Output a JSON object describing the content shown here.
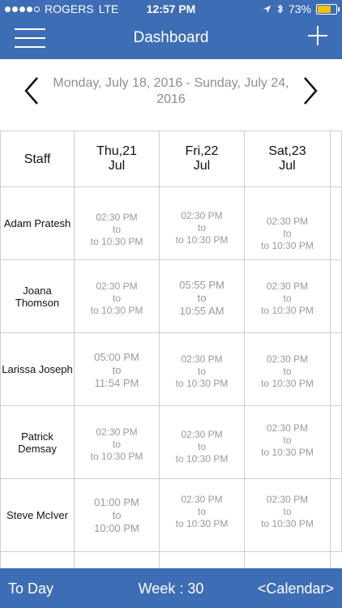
{
  "status": {
    "carrier": "ROGERS",
    "network": "LTE",
    "time": "12:57 PM",
    "battery": "73%",
    "battery_level": 0.73,
    "signal_bars": 4,
    "icons": [
      "location-icon",
      "bluetooth-icon"
    ]
  },
  "header": {
    "title": "Dashboard",
    "menu_icon": "hamburger-icon",
    "add_icon": "plus-icon"
  },
  "week": {
    "range": "Monday, July 18, 2016 - Sunday, July 24, 2016",
    "prev_icon": "chevron-left-icon",
    "next_icon": "chevron-right-icon"
  },
  "table": {
    "staff_header": "Staff",
    "days": [
      {
        "day": "Thu,21",
        "month": "Jul"
      },
      {
        "day": "Fri,22",
        "month": "Jul"
      },
      {
        "day": "Sat,23",
        "month": "Jul"
      }
    ],
    "rows": [
      {
        "name": "Adam  Pratesh",
        "shifts": [
          {
            "start": "02:30 PM",
            "sep": "to",
            "end": "to 10:30 PM"
          },
          {
            "start": "02:30 PM",
            "sep": "to",
            "end": "to 10:30 PM"
          },
          {
            "start": "02:30 PM",
            "sep": "to",
            "end": "to 10:30 PM"
          }
        ]
      },
      {
        "name": "Joana Thomson",
        "shifts": [
          {
            "start": "02:30 PM",
            "sep": "to",
            "end": "to 10:30 PM"
          },
          {
            "start": "05:55 PM",
            "sep": "to",
            "end": "10:55 AM"
          },
          {
            "start": "02:30 PM",
            "sep": "to",
            "end": "to 10:30 PM"
          }
        ]
      },
      {
        "name": "Larissa Joseph",
        "shifts": [
          {
            "start": "05:00 PM",
            "sep": "to",
            "end": "11:54 PM"
          },
          {
            "start": "02:30 PM",
            "sep": "to",
            "end": "to 10:30 PM"
          },
          {
            "start": "02:30 PM",
            "sep": "to",
            "end": "to 10:30 PM"
          }
        ]
      },
      {
        "name": "Patrick Demsay",
        "shifts": [
          {
            "start": "02:30 PM",
            "sep": "to",
            "end": "to 10:30 PM"
          },
          {
            "start": "02:30 PM",
            "sep": "to",
            "end": "to 10:30 PM"
          },
          {
            "start": "02:30 PM",
            "sep": "to",
            "end": "to 10:30 PM"
          }
        ]
      },
      {
        "name": "Steve McIver",
        "shifts": [
          {
            "start": "01:00 PM",
            "sep": "to",
            "end": "10:00 PM"
          },
          {
            "start": "02:30 PM",
            "sep": "to",
            "end": "to 10:30 PM"
          },
          {
            "start": "02:30 PM",
            "sep": "to",
            "end": "to 10:30 PM"
          }
        ]
      }
    ]
  },
  "footer": {
    "today": "To Day",
    "week": "Week : 30",
    "calendar": "<Calendar>"
  },
  "colors": {
    "brand": "#3d6db5",
    "grid_line": "#cfcfcf",
    "muted_text": "#9a9a9a",
    "battery": "#f2c200"
  }
}
